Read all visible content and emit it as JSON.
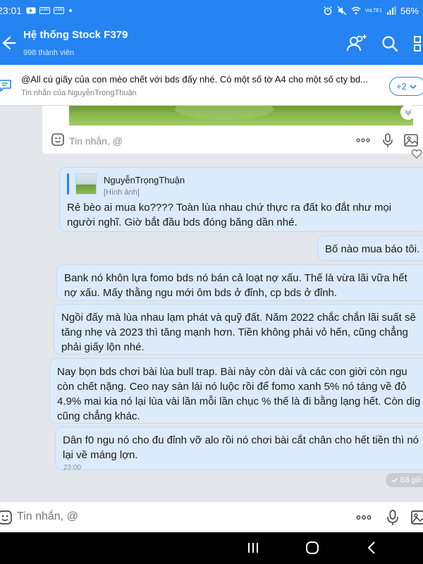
{
  "status_bar": {
    "time": "23:01",
    "apps": [
      "Zalo",
      "Zalo"
    ],
    "net_label": "VoLTE1",
    "battery": "56%"
  },
  "header": {
    "title": "Hệ thống Stock F379",
    "members": "998 thành viên"
  },
  "pinned": {
    "text": "@All cú giãy của con mèo chết với bds đấy nhé. Có một số tờ A4 cho một số cty bd...",
    "sub": "Tin nhắn của NguyễnTrọngThuận",
    "count": "+2"
  },
  "overlay_input": {
    "placeholder": "Tin nhắn, @"
  },
  "messages": {
    "quote": {
      "author": "NguyễnTrọngThuận",
      "type": "[Hình ảnh]",
      "text": "Rẻ bèo ai mua ko???? Toàn lùa nhau chứ thực ra đất ko đắt như mọi người nghĩ. Giờ bắt đầu bds đóng băng dần nhé."
    },
    "m2": "Bố nào mua báo tôi.",
    "m3": "Bank nó khôn lựa fomo bds nó bán cả loạt nợ xấu. Thế là vừa lãi vữa hết nợ xấu. Mấy thằng ngu mới ôm bds ở đỉnh, cp bds ở đỉnh.",
    "m4": "Ngồi đấy mà lùa nhau lạm phát và quỹ đất. Năm 2022 chắc chắn lãi suất sẽ tăng nhẹ và 2023 thì tăng mạnh hơn. Tiền không phải vỏ hến, cũng chẳng phải giấy lộn nhé.",
    "m5": "Nay bọn bds chơi bài lùa bull trap. Bài này còn dài và các con giời còn ngu còn chết nặng. Ceo nay sàn lái nó luộc rồi để fomo xanh 5% nó táng về đỏ 4.9% mai kia nó lại lùa vài lần mỗi lần chục % thế là đi bằng lạng hết. Còn dig cũng chẳng khác.",
    "m6": "Dân f0 ngu nó cho đu đỉnh vỡ alo rồi nó chơi bài cắt chân cho hết tiền thì nó lại về máng lợn.",
    "m6_time": "23:00",
    "sent_status": "Đã gửi"
  },
  "bottom_input": {
    "placeholder": "Tin nhắn, @"
  },
  "colors": {
    "accent": "#2583f2",
    "bubble": "#dbebfb",
    "background": "#e3e6ea"
  },
  "icons": [
    "back-arrow-icon",
    "add-member-icon",
    "search-icon",
    "grid-menu-icon",
    "pinned-message-icon",
    "chevron-down-icon",
    "emoji-icon",
    "more-icon",
    "microphone-icon",
    "image-icon",
    "heart-icon",
    "check-icon"
  ]
}
